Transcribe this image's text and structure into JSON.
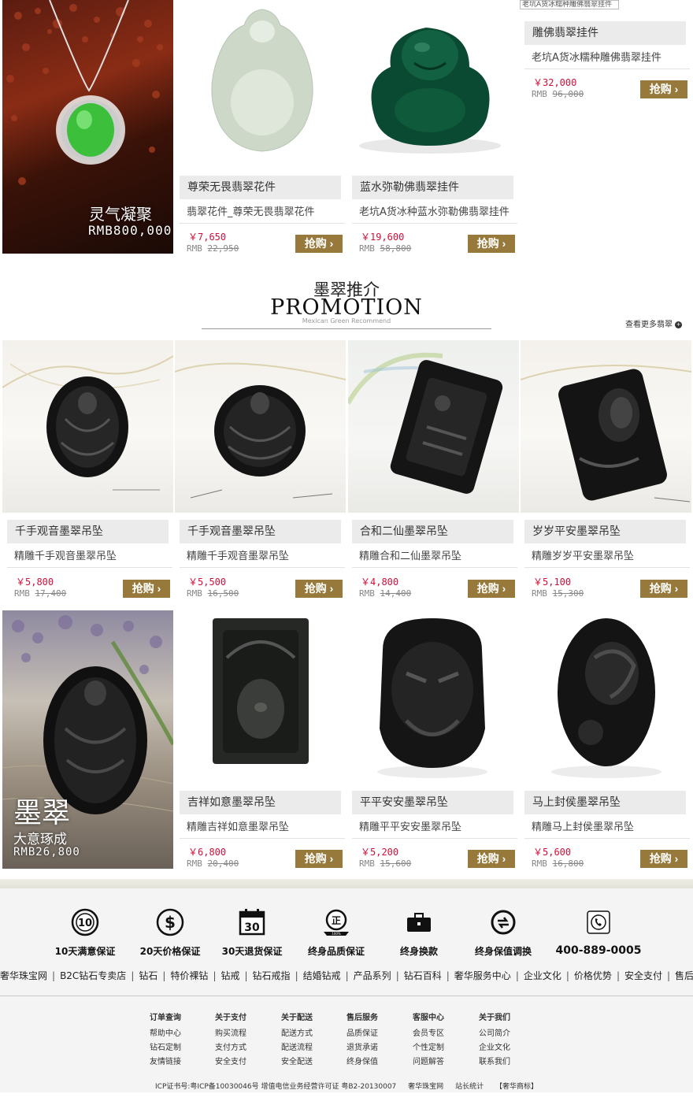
{
  "top_banner": {
    "title": "灵气凝聚",
    "price": "RMB800,000"
  },
  "top_products": [
    {
      "name": "尊荣无畏翡翠花件",
      "subtitle": "翡翠花件_尊荣无畏翡翠花件",
      "price": "￥7,650",
      "old_label": "RMB",
      "old_price": "22,950",
      "buy": "抢购"
    },
    {
      "name": "蓝水弥勒佛翡翠挂件",
      "subtitle": "老坑A货冰种蓝水弥勒佛翡翠挂件",
      "price": "￥19,600",
      "old_label": "RMB",
      "old_price": "58,800",
      "buy": "抢购"
    },
    {
      "name": "雕佛翡翠挂件",
      "subtitle": "老坑A货冰糯种雕佛翡翠挂件",
      "price": "￥32,000",
      "old_label": "RMB",
      "old_price": "96,000",
      "buy": "抢购",
      "broken_image_alt": "老坑A货冰糯种雕佛翡翠挂件"
    }
  ],
  "section": {
    "title_cn": "墨翠推介",
    "title_en": "PROMOTION",
    "subtitle_en": "Mexican Green Recommend",
    "more_link": "查看更多翡翠",
    "more_icon": "+"
  },
  "promo_row1": [
    {
      "name": "千手观音墨翠吊坠",
      "subtitle": "精雕千手观音墨翠吊坠",
      "price": "￥5,800",
      "old_label": "RMB",
      "old_price": "17,400",
      "buy": "抢购"
    },
    {
      "name": "千手观音墨翠吊坠",
      "subtitle": "精雕千手观音墨翠吊坠",
      "price": "￥5,500",
      "old_label": "RMB",
      "old_price": "16,500",
      "buy": "抢购"
    },
    {
      "name": "合和二仙墨翠吊坠",
      "subtitle": "精雕合和二仙墨翠吊坠",
      "price": "￥4,800",
      "old_label": "RMB",
      "old_price": "14,400",
      "buy": "抢购"
    },
    {
      "name": "岁岁平安墨翠吊坠",
      "subtitle": "精雕岁岁平安墨翠吊坠",
      "price": "￥5,100",
      "old_label": "RMB",
      "old_price": "15,300",
      "buy": "抢购"
    }
  ],
  "moi_banner": {
    "title": "墨翠",
    "subtitle": "大意琢成",
    "price": "RMB26,800"
  },
  "promo_row2": [
    {
      "name": "吉祥如意墨翠吊坠",
      "subtitle": "精雕吉祥如意墨翠吊坠",
      "price": "￥6,800",
      "old_label": "RMB",
      "old_price": "20,400",
      "buy": "抢购"
    },
    {
      "name": "平平安安墨翠吊坠",
      "subtitle": "精雕平平安安墨翠吊坠",
      "price": "￥5,200",
      "old_label": "RMB",
      "old_price": "15,600",
      "buy": "抢购"
    },
    {
      "name": "马上封侯墨翠吊坠",
      "subtitle": "精雕马上封侯墨翠吊坠",
      "price": "￥5,600",
      "old_label": "RMB",
      "old_price": "16,800",
      "buy": "抢购"
    }
  ],
  "services": [
    {
      "label": "10天满意保证",
      "icon": "10-day-badge-icon",
      "icon_text": "10"
    },
    {
      "label": "20天价格保证",
      "icon": "dollar-coin-icon",
      "icon_text": "$"
    },
    {
      "label": "30天退货保证",
      "icon": "calendar-30-icon",
      "icon_text": "30"
    },
    {
      "label": "终身品质保证",
      "icon": "quality-seal-icon",
      "icon_text": "正",
      "icon_subtext": "100%"
    },
    {
      "label": "终身换款",
      "icon": "briefcase-icon"
    },
    {
      "label": "终身保值调换",
      "icon": "exchange-cycle-icon"
    },
    {
      "label": "400-889-0005",
      "icon": "phone-icon"
    }
  ],
  "nav_links": [
    "奢华珠宝网",
    "B2C钻石专卖店",
    "钻石",
    "特价裸钻",
    "钻戒",
    "钻石戒指",
    "结婚钻戒",
    "产品系列",
    "钻石百科",
    "奢华服务中心",
    "企业文化",
    "价格优势",
    "安全支付",
    "售后服务"
  ],
  "footer_columns": [
    {
      "title": "订单查询",
      "links": [
        "帮助中心",
        "钻石定制",
        "友情链接"
      ]
    },
    {
      "title": "关于支付",
      "links": [
        "购买流程",
        "支付方式",
        "安全支付"
      ]
    },
    {
      "title": "关于配送",
      "links": [
        "配送方式",
        "配送流程",
        "安全配送"
      ]
    },
    {
      "title": "售后服务",
      "links": [
        "品质保证",
        "退货承诺",
        "终身保值"
      ]
    },
    {
      "title": "客服中心",
      "links": [
        "会员专区",
        "个性定制",
        "问题解答"
      ]
    },
    {
      "title": "关于我们",
      "links": [
        "公司简介",
        "企业文化",
        "联系我们"
      ]
    }
  ],
  "icp": [
    "ICP证书号:粤ICP备10030046号 增值电信业务经营许可证 粤B2-20130007",
    "奢华珠宝网",
    "站长统计",
    "【奢华商标】"
  ],
  "colors": {
    "buy_button": "#977a3b",
    "price": "#d0103a",
    "name_bar": "#ebebeb",
    "footer_bg": "#f4f4f4"
  }
}
